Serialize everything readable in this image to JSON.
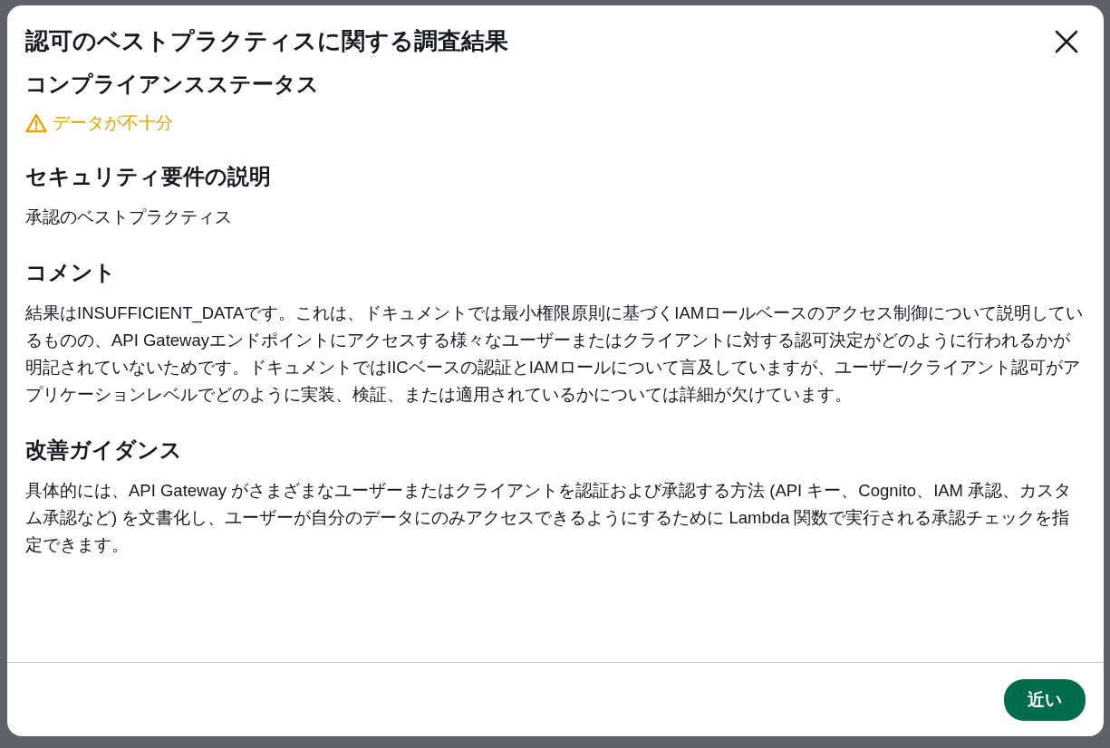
{
  "dialog": {
    "title": "認可のベストプラクティスに関する調査結果",
    "sections": [
      {
        "heading": "コンプライアンスステータス",
        "kind": "status",
        "status": {
          "kind": "warning",
          "text": "データが不十分"
        }
      },
      {
        "heading": "セキュリティ要件の説明",
        "kind": "text",
        "text": "承認のベストプラクティス"
      },
      {
        "heading": "コメント",
        "kind": "text",
        "text": "結果はINSUFFICIENT_DATAです。これは、ドキュメントでは最小権限原則に基づくIAMロールベースのアクセス制御について説明しているものの、API Gatewayエンドポイントにアクセスする様々なユーザーまたはクライアントに対する認可決定がどのように行われるかが明記されていないためです。ドキュメントではIICベースの認証とIAMロールについて言及していますが、ユーザー/クライアント認可がアプリケーションレベルでどのように実装、検証、または適用されているかについては詳細が欠けています。"
      },
      {
        "heading": "改善ガイダンス",
        "kind": "text",
        "text": "具体的には、API Gateway がさまざまなユーザーまたはクライアントを認証および承認する方法 (API キー、Cognito、IAM 承認、カスタム承認など) を文書化し、ユーザーが自分のデータにのみアクセスできるようにするために Lambda 関数で実行される承認チェックを指定できます。"
      }
    ],
    "close_button": "近い"
  }
}
